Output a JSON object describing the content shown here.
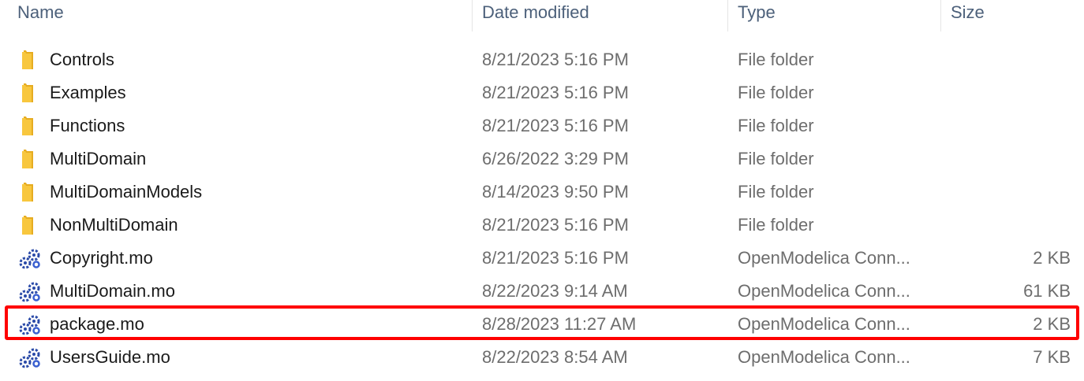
{
  "columns": {
    "name": "Name",
    "date": "Date modified",
    "type": "Type",
    "size": "Size"
  },
  "files": [
    {
      "name": "Controls",
      "date": "8/21/2023 5:16 PM",
      "type": "File folder",
      "size": "",
      "icon": "folder-icon"
    },
    {
      "name": "Examples",
      "date": "8/21/2023 5:16 PM",
      "type": "File folder",
      "size": "",
      "icon": "folder-icon"
    },
    {
      "name": "Functions",
      "date": "8/21/2023 5:16 PM",
      "type": "File folder",
      "size": "",
      "icon": "folder-icon"
    },
    {
      "name": "MultiDomain",
      "date": "6/26/2022 3:29 PM",
      "type": "File folder",
      "size": "",
      "icon": "folder-icon"
    },
    {
      "name": "MultiDomainModels",
      "date": "8/14/2023 9:50 PM",
      "type": "File folder",
      "size": "",
      "icon": "folder-icon"
    },
    {
      "name": "NonMultiDomain",
      "date": "8/21/2023 5:16 PM",
      "type": "File folder",
      "size": "",
      "icon": "folder-icon"
    },
    {
      "name": "Copyright.mo",
      "date": "8/21/2023 5:16 PM",
      "type": "OpenModelica Conn...",
      "size": "2 KB",
      "icon": "modelica-file-icon"
    },
    {
      "name": "MultiDomain.mo",
      "date": "8/22/2023 9:14 AM",
      "type": "OpenModelica Conn...",
      "size": "61 KB",
      "icon": "modelica-file-icon"
    },
    {
      "name": "package.mo",
      "date": "8/28/2023 11:27 AM",
      "type": "OpenModelica Conn...",
      "size": "2 KB",
      "icon": "modelica-file-icon"
    },
    {
      "name": "UsersGuide.mo",
      "date": "8/22/2023 8:54 AM",
      "type": "OpenModelica Conn...",
      "size": "7 KB",
      "icon": "modelica-file-icon"
    }
  ],
  "colors": {
    "highlight": "#ff0000",
    "folder": "#f8c73e",
    "modelica_icon": "#2a4aa8"
  }
}
